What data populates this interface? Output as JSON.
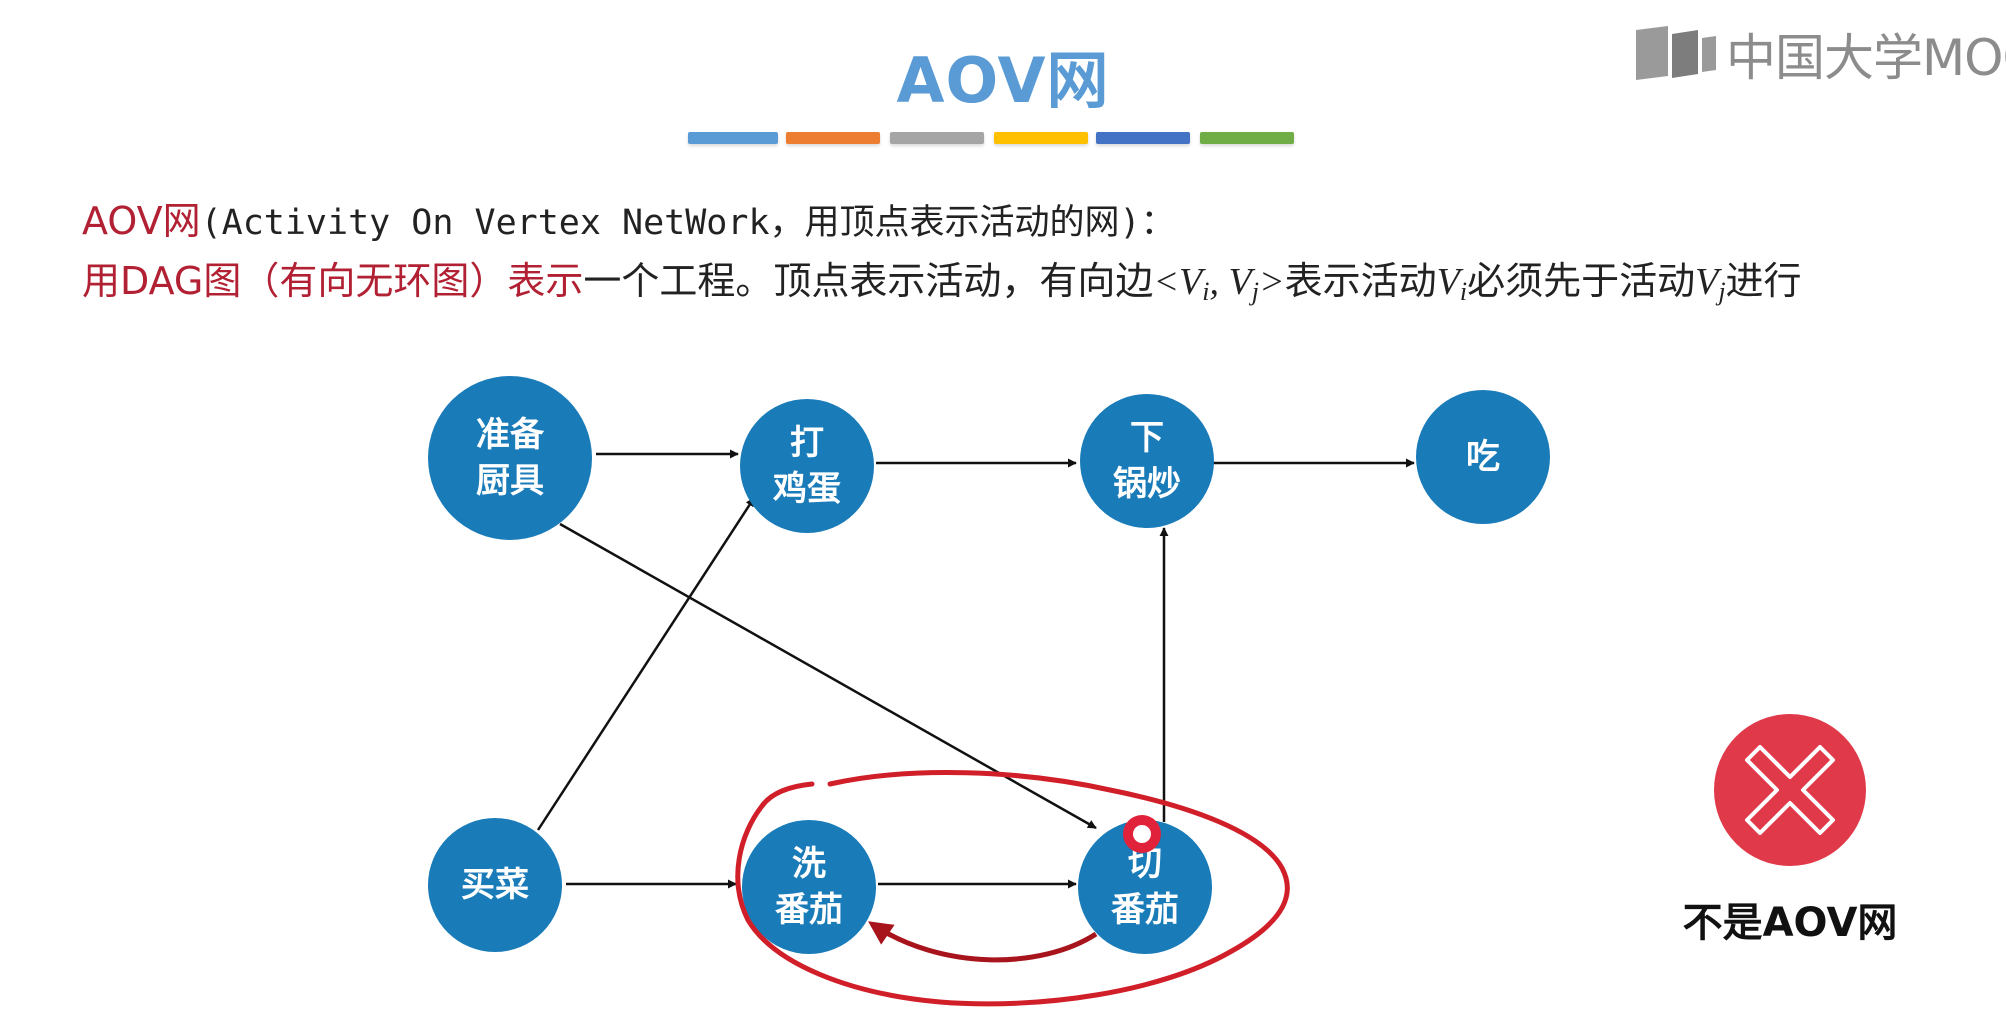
{
  "slide": {
    "title": "AOV网",
    "title_bar_colors": [
      "#5b9bd5",
      "#ed7d31",
      "#a5a5a5",
      "#ffc000",
      "#4472c4",
      "#70ad47"
    ],
    "logo_text": "中国大学MOOC"
  },
  "definition": {
    "line1_term": "AOV网",
    "line1_rest": "(Activity On Vertex NetWork，用顶点表示活动的网)：",
    "line2_red": "用DAG图（有向无环图）表示",
    "line2_text_a": "一个工程。顶点表示活动，有向边",
    "line2_edge_open": "<",
    "line2_vi": "V",
    "line2_i": "i",
    "line2_comma": ", ",
    "line2_vj": "V",
    "line2_j": "j",
    "line2_edge_close": ">",
    "line2_text_b": "表示活动",
    "line2_text_c": "必须先于活动",
    "line2_text_d": "进行"
  },
  "graph": {
    "nodes": [
      {
        "id": "prepare",
        "lines": [
          "准备",
          "厨具"
        ]
      },
      {
        "id": "beat-egg",
        "lines": [
          "打",
          "鸡蛋"
        ]
      },
      {
        "id": "stir-fry",
        "lines": [
          "下",
          "锅炒"
        ]
      },
      {
        "id": "eat",
        "lines": [
          "吃"
        ]
      },
      {
        "id": "buy",
        "lines": [
          "买菜"
        ]
      },
      {
        "id": "wash-tomato",
        "lines": [
          "洗",
          "番茄"
        ]
      },
      {
        "id": "cut-tomato",
        "lines": [
          "切",
          "番茄"
        ]
      }
    ],
    "edges": [
      {
        "from": "prepare",
        "to": "beat-egg"
      },
      {
        "from": "beat-egg",
        "to": "stir-fry"
      },
      {
        "from": "stir-fry",
        "to": "eat"
      },
      {
        "from": "prepare",
        "to": "cut-tomato"
      },
      {
        "from": "buy",
        "to": "beat-egg"
      },
      {
        "from": "buy",
        "to": "wash-tomato"
      },
      {
        "from": "wash-tomato",
        "to": "cut-tomato"
      },
      {
        "from": "cut-tomato",
        "to": "stir-fry"
      },
      {
        "from": "cut-tomato",
        "to": "wash-tomato",
        "highlighted": true
      }
    ],
    "highlight_color": "#d11f2a"
  },
  "verdict": {
    "label": "不是AOV网",
    "icon": "close-icon",
    "color": "#e03a4a"
  }
}
